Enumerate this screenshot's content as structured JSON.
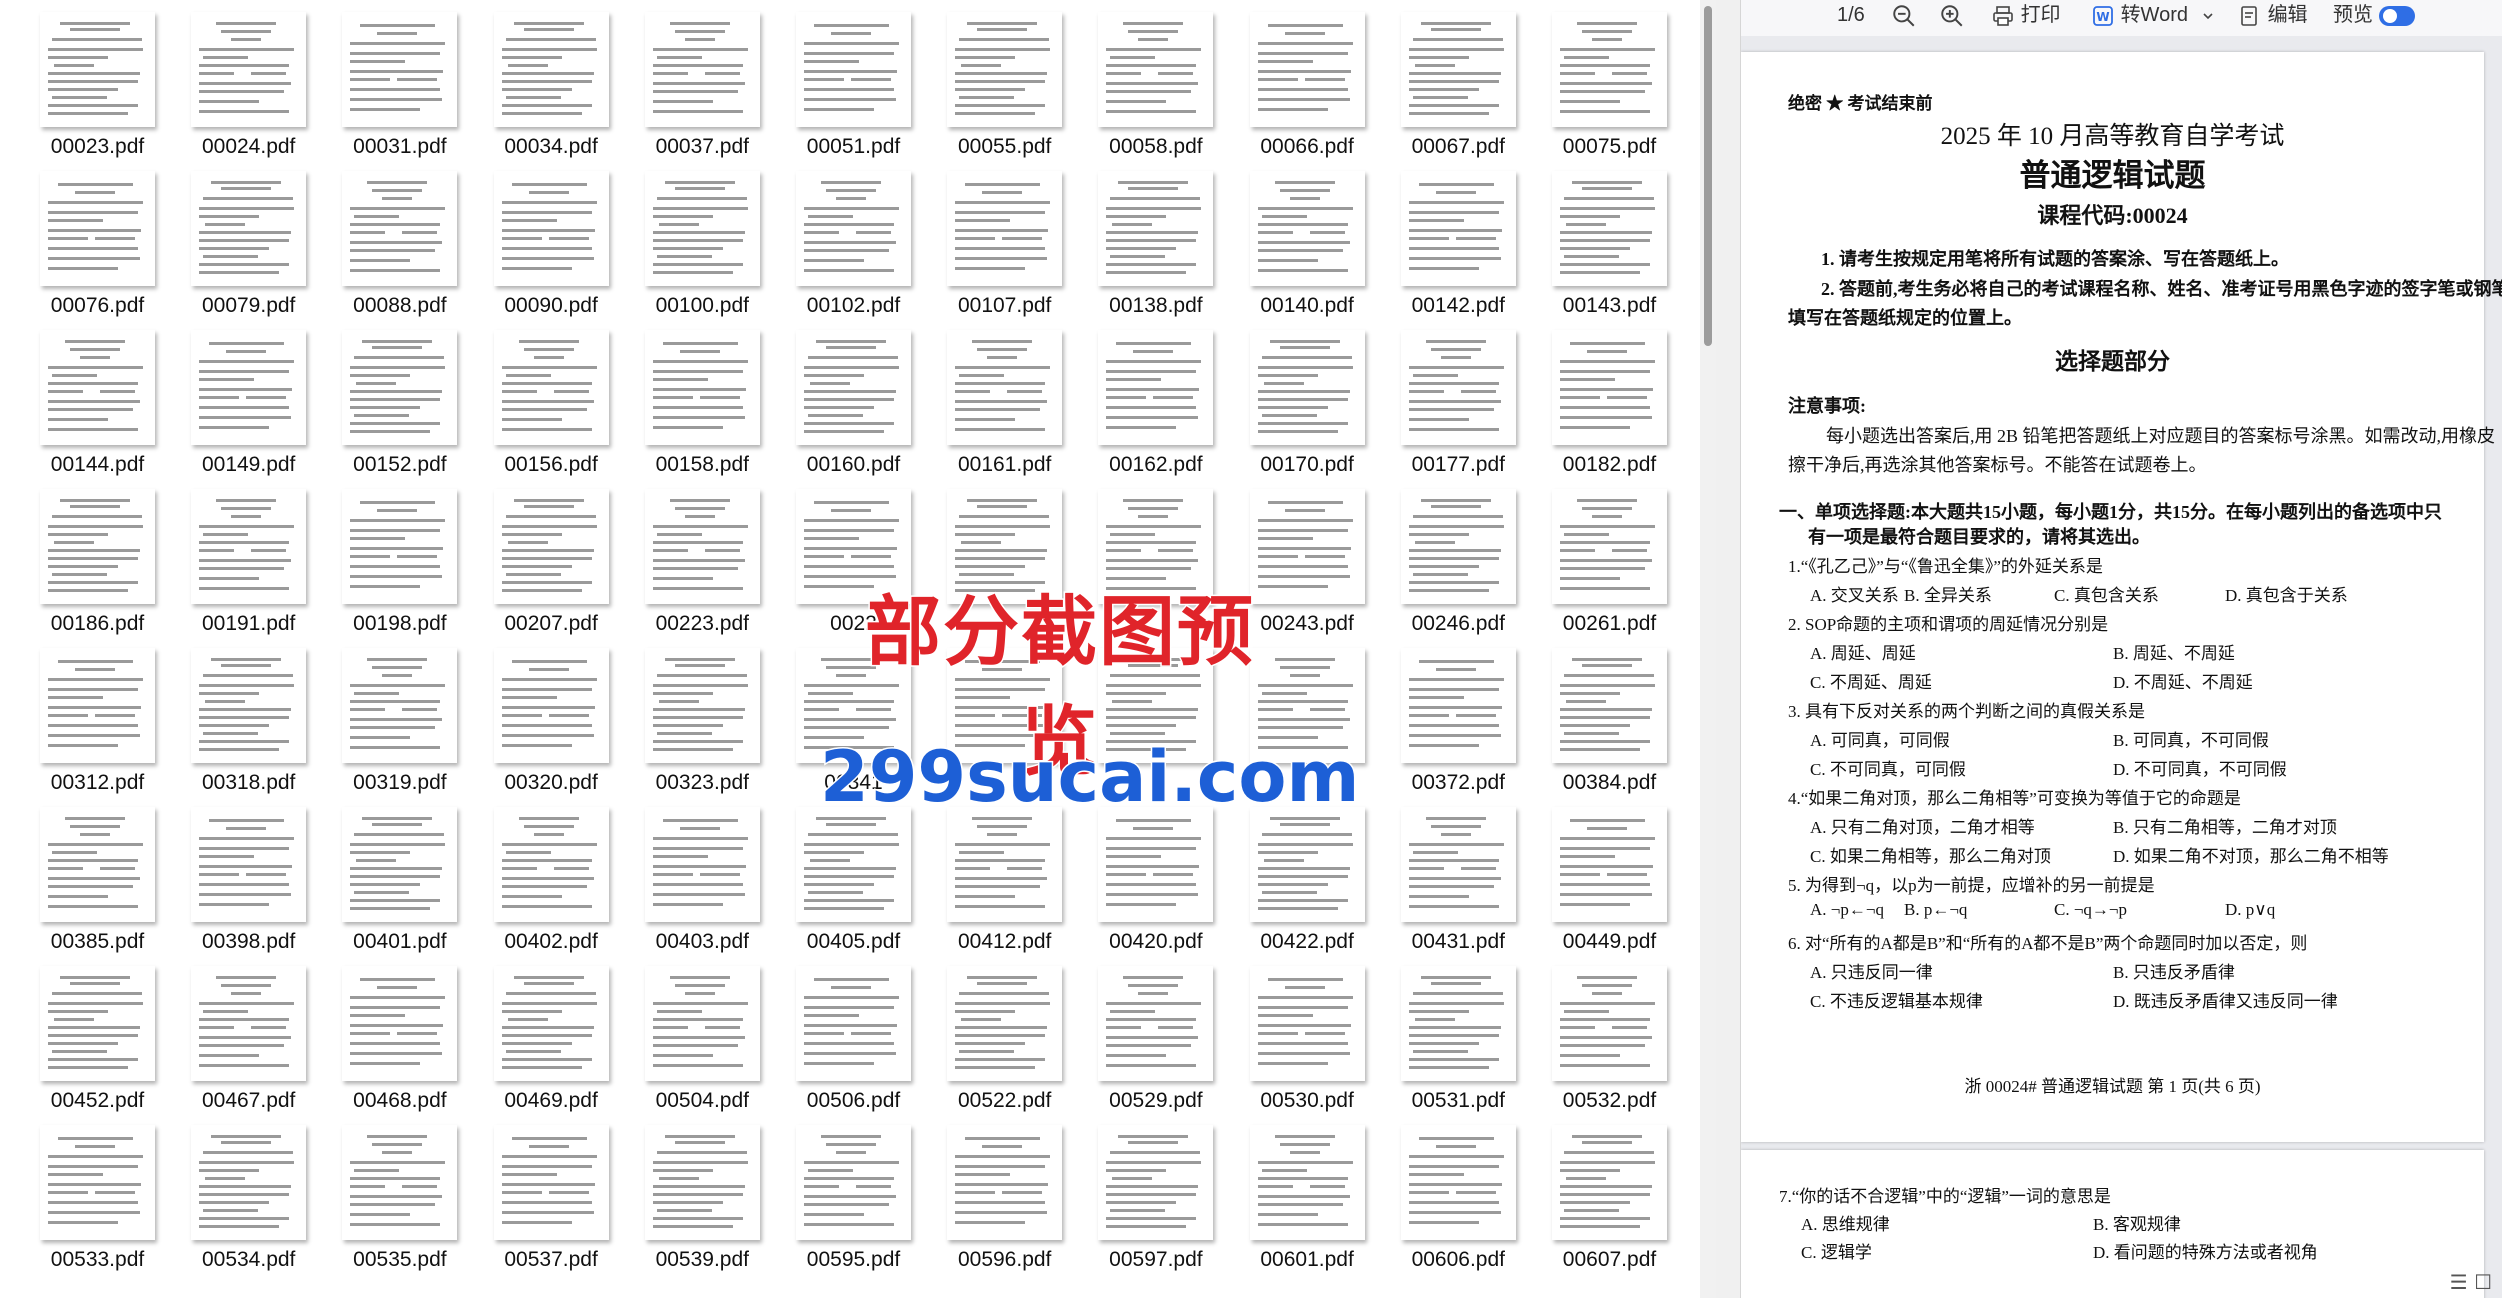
{
  "files": [
    "00023.pdf",
    "00024.pdf",
    "00031.pdf",
    "00034.pdf",
    "00037.pdf",
    "00051.pdf",
    "00055.pdf",
    "00058.pdf",
    "00066.pdf",
    "00067.pdf",
    "00075.pdf",
    "00076.pdf",
    "00079.pdf",
    "00088.pdf",
    "00090.pdf",
    "00100.pdf",
    "00102.pdf",
    "00107.pdf",
    "00138.pdf",
    "00140.pdf",
    "00142.pdf",
    "00143.pdf",
    "00144.pdf",
    "00149.pdf",
    "00152.pdf",
    "00156.pdf",
    "00158.pdf",
    "00160.pdf",
    "00161.pdf",
    "00162.pdf",
    "00170.pdf",
    "00177.pdf",
    "00182.pdf",
    "00186.pdf",
    "00191.pdf",
    "00198.pdf",
    "00207.pdf",
    "00223.pdf",
    "0022",
    "",
    "",
    "00243.pdf",
    "00246.pdf",
    "00261.pdf",
    "00312.pdf",
    "00318.pdf",
    "00319.pdf",
    "00320.pdf",
    "00323.pdf",
    "00341",
    "",
    "",
    "",
    "00372.pdf",
    "00384.pdf",
    "00385.pdf",
    "00398.pdf",
    "00401.pdf",
    "00402.pdf",
    "00403.pdf",
    "00405.pdf",
    "00412.pdf",
    "00420.pdf",
    "00422.pdf",
    "00431.pdf",
    "00449.pdf",
    "00452.pdf",
    "00467.pdf",
    "00468.pdf",
    "00469.pdf",
    "00504.pdf",
    "00506.pdf",
    "00522.pdf",
    "00529.pdf",
    "00530.pdf",
    "00531.pdf",
    "00532.pdf",
    "00533.pdf",
    "00534.pdf",
    "00535.pdf",
    "00537.pdf",
    "00539.pdf",
    "00595.pdf",
    "00596.pdf",
    "00597.pdf",
    "00601.pdf",
    "00606.pdf",
    "00607.pdf"
  ],
  "toolbar": {
    "page_indicator": "1/6",
    "print_label": "打印",
    "to_word_label": "转Word",
    "edit_label": "编辑",
    "preview_label": "预览",
    "accent_color": "#2f6ee5"
  },
  "doc": {
    "secret": "绝密 ★ 考试结束前",
    "exam_title": "2025 年 10 月高等教育自学考试",
    "subject": "普通逻辑试题",
    "course_code": "课程代码:00024",
    "instr1": "1. 请考生按规定用笔将所有试题的答案涂、写在答题纸上。",
    "instr2a": "2. 答题前,考生务必将自己的考试课程名称、姓名、准考证号用黑色字迹的签字笔或钢笔",
    "instr2b": "填写在答题纸规定的位置上。",
    "section_title": "选择题部分",
    "notes_title": "注意事项:",
    "notes_a": "每小题选出答案后,用 2B 铅笔把答题纸上对应题目的答案标号涂黑。如需改动,用橡皮",
    "notes_b": "擦干净后,再选涂其他答案标号。不能答在试题卷上。",
    "part1a": "一、单项选择题:本大题共15小题，每小题1分，共15分。在每小题列出的备选项中只",
    "part1b": "有一项是最符合题目要求的，请将其选出。",
    "questions": [
      {
        "stem": "1.“《孔乙己》”与“《鲁迅全集》”的外延关系是",
        "layout": "row",
        "options": [
          "A. 交叉关系",
          "B. 全异关系",
          "C. 真包含关系",
          "D. 真包含于关系"
        ]
      },
      {
        "stem": "2. SOP命题的主项和谓项的周延情况分别是",
        "layout": "grid",
        "options": [
          "A. 周延、周延",
          "B. 周延、不周延",
          "C. 不周延、周延",
          "D. 不周延、不周延"
        ]
      },
      {
        "stem": "3. 具有下反对关系的两个判断之间的真假关系是",
        "layout": "grid",
        "options": [
          "A. 可同真，可同假",
          "B. 可同真，不可同假",
          "C. 不可同真，可同假",
          "D. 不可同真，不可同假"
        ]
      },
      {
        "stem": "4.“如果二角对顶，那么二角相等”可变换为等值于它的命题是",
        "layout": "grid",
        "options": [
          "A. 只有二角对顶，二角才相等",
          "B. 只有二角相等，二角才对顶",
          "C. 如果二角相等，那么二角对顶",
          "D. 如果二角不对顶，那么二角不相等"
        ]
      },
      {
        "stem": "5. 为得到¬q，以p为一前提，应增补的另一前提是",
        "layout": "row",
        "options": [
          "A. ¬p←¬q",
          "B. p←¬q",
          "C. ¬q→¬p",
          "D. p∨q"
        ]
      },
      {
        "stem": "6. 对“所有的A都是B”和“所有的A都不是B”两个命题同时加以否定，则",
        "layout": "grid",
        "options": [
          "A. 只违反同一律",
          "B. 只违反矛盾律",
          "C. 不违反逻辑基本规律",
          "D. 既违反矛盾律又违反同一律"
        ]
      }
    ],
    "footer": "浙 00024# 普通逻辑试题 第 1 页(共 6 页)",
    "page2": {
      "stem": "7.“你的话不合逻辑”中的“逻辑”一词的意思是",
      "options": [
        "A. 思维规律",
        "B. 客观规律",
        "C. 逻辑学",
        "D. 看问题的特殊方法或者视角"
      ]
    }
  },
  "watermark": {
    "line1": "部分截图预览",
    "line2": "299sucai.com",
    "color1": "#e0242a",
    "color2": "#1d5fd6"
  }
}
